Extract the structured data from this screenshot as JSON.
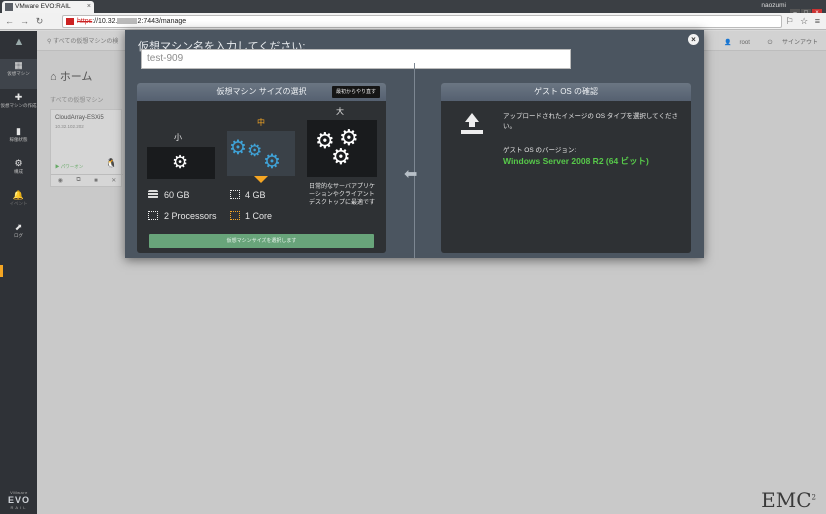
{
  "browser": {
    "tab_title": "VMware EVO:RAIL",
    "tab_close": "×",
    "window_user": "naozumi",
    "url_scheme": "https",
    "url_host": "://10.32.",
    "url_rest": "2:7443/manage",
    "ext_icons": "⚐ ☆ ≡"
  },
  "sidebar": {
    "items": [
      {
        "icon": "▦",
        "label": "仮想マシン"
      },
      {
        "icon": "✚",
        "label": "仮想マシンの作成"
      },
      {
        "icon": "▮",
        "label": "稼働状態"
      },
      {
        "icon": "⚙",
        "label": "構成"
      },
      {
        "icon": "🔔",
        "label": "イベント"
      },
      {
        "icon": "⬈",
        "label": "ログ"
      }
    ],
    "footer": {
      "line1": "VMware",
      "line2": "EVO",
      "line3": "RAIL"
    }
  },
  "app": {
    "search_placeholder": "すべての仮想マシンの検",
    "user": "root",
    "logout": "サインアウト",
    "page_title": "ホーム",
    "page_sub": "すべての仮想マシン",
    "vm_card": {
      "name": "CloudArray-ESXi5",
      "ip": "10.32.102.202",
      "state": "▶ パワーオン",
      "os_icon": "🐧"
    },
    "emc_logo": "EMC",
    "emc_sup": "2"
  },
  "modal": {
    "close": "×",
    "name_label": "仮想マシン名を入力してください:",
    "name_value": "test-909",
    "size_panel": {
      "title": "仮想マシン サイズの選択",
      "reset": "最初からやり直す",
      "sizes": {
        "small": "小",
        "medium": "中",
        "large": "大"
      },
      "selected": "medium",
      "storage": "60 GB",
      "memory": "4 GB",
      "cpu": "2 Processors",
      "cores": "1 Core",
      "large_desc": "日常的なサーバアプリケーションやクライアント デスクトップに最適です",
      "select_btn": "仮想マシンサイズを選択します"
    },
    "os_panel": {
      "title": "ゲスト OS の確認",
      "desc": "アップロードされたイメージの OS タイプを選択してください。",
      "ver_label": "ゲスト OS のバージョン:",
      "ver_value": "Windows Server 2008 R2 (64 ビット)"
    }
  }
}
